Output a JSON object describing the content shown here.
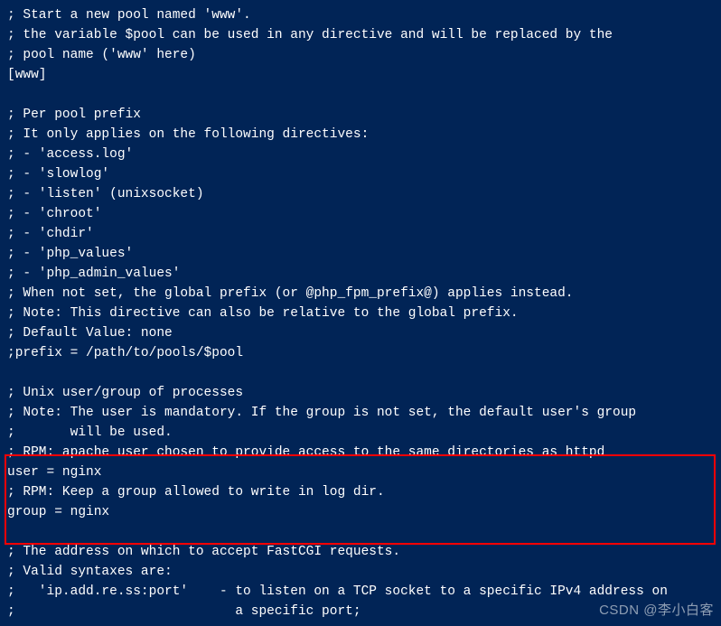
{
  "lines": [
    "; Start a new pool named 'www'.",
    "; the variable $pool can be used in any directive and will be replaced by the",
    "; pool name ('www' here)",
    "[www]",
    "",
    "; Per pool prefix",
    "; It only applies on the following directives:",
    "; - 'access.log'",
    "; - 'slowlog'",
    "; - 'listen' (unixsocket)",
    "; - 'chroot'",
    "; - 'chdir'",
    "; - 'php_values'",
    "; - 'php_admin_values'",
    "; When not set, the global prefix (or @php_fpm_prefix@) applies instead.",
    "; Note: This directive can also be relative to the global prefix.",
    "; Default Value: none",
    ";prefix = /path/to/pools/$pool",
    "",
    "; Unix user/group of processes",
    "; Note: The user is mandatory. If the group is not set, the default user's group",
    ";       will be used.",
    "; RPM: apache user chosen to provide access to the same directories as httpd",
    "user = nginx",
    "; RPM: Keep a group allowed to write in log dir.",
    "group = nginx",
    "",
    "; The address on which to accept FastCGI requests.",
    "; Valid syntaxes are:",
    ";   'ip.add.re.ss:port'    - to listen on a TCP socket to a specific IPv4 address on",
    ";                            a specific port;"
  ],
  "watermark": "CSDN @李小白客"
}
